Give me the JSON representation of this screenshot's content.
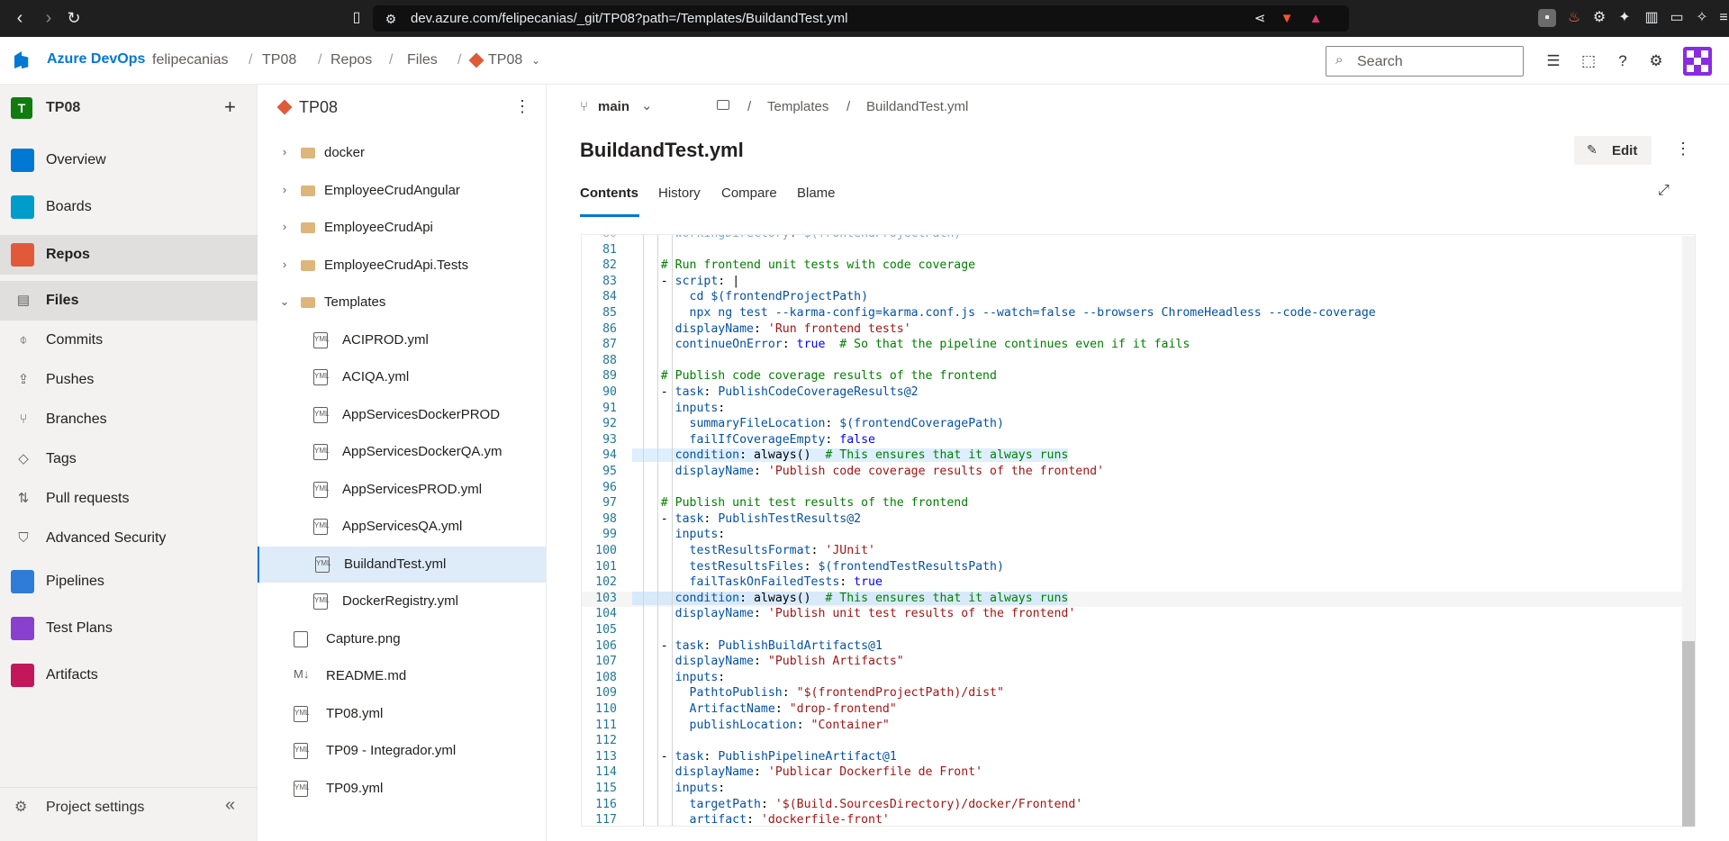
{
  "browser": {
    "url": "dev.azure.com/felipecanias/_git/TP08?path=/Templates/BuildandTest.yml",
    "nav_icons": [
      "back-icon",
      "forward-icon",
      "reload-icon",
      "bookmark-icon"
    ]
  },
  "header": {
    "brand": "Azure DevOps",
    "breadcrumbs": [
      "felipecanias",
      "TP08",
      "Repos",
      "Files",
      "TP08"
    ],
    "search_placeholder": "Search",
    "accent": "#0078d4"
  },
  "project": {
    "initial": "T",
    "name": "TP08",
    "add": "+"
  },
  "nav": {
    "items": [
      {
        "label": "Overview",
        "color": "#0078d4"
      },
      {
        "label": "Boards",
        "color": "#009ccc"
      },
      {
        "label": "Repos",
        "color": "#e05a3a"
      }
    ],
    "repos_sub": [
      {
        "label": "Files",
        "icon": "file-icon"
      },
      {
        "label": "Commits",
        "icon": "commit-icon"
      },
      {
        "label": "Pushes",
        "icon": "push-icon"
      },
      {
        "label": "Branches",
        "icon": "branch-icon"
      },
      {
        "label": "Tags",
        "icon": "tag-icon"
      },
      {
        "label": "Pull requests",
        "icon": "pull-request-icon"
      },
      {
        "label": "Advanced Security",
        "icon": "shield-icon"
      }
    ],
    "bottom_items": [
      {
        "label": "Pipelines",
        "color": "#2e7cd6"
      },
      {
        "label": "Test Plans",
        "color": "#8a3fcf"
      },
      {
        "label": "Artifacts",
        "color": "#c2185b"
      }
    ],
    "settings": "Project settings"
  },
  "tree": {
    "repo": "TP08",
    "items": [
      {
        "label": "docker",
        "type": "folder",
        "level": 0,
        "expanded": false
      },
      {
        "label": "EmployeeCrudAngular",
        "type": "folder",
        "level": 0,
        "expanded": false
      },
      {
        "label": "EmployeeCrudApi",
        "type": "folder",
        "level": 0,
        "expanded": false
      },
      {
        "label": "EmployeeCrudApi.Tests",
        "type": "folder",
        "level": 0,
        "expanded": false
      },
      {
        "label": "Templates",
        "type": "folder",
        "level": 0,
        "expanded": true
      },
      {
        "label": "ACIPROD.yml",
        "type": "file",
        "level": 1
      },
      {
        "label": "ACIQA.yml",
        "type": "file",
        "level": 1
      },
      {
        "label": "AppServicesDockerPROD",
        "type": "file",
        "level": 1
      },
      {
        "label": "AppServicesDockerQA.ym",
        "type": "file",
        "level": 1
      },
      {
        "label": "AppServicesPROD.yml",
        "type": "file",
        "level": 1
      },
      {
        "label": "AppServicesQA.yml",
        "type": "file",
        "level": 1
      },
      {
        "label": "BuildandTest.yml",
        "type": "file",
        "level": 1,
        "selected": true
      },
      {
        "label": "DockerRegistry.yml",
        "type": "file",
        "level": 1
      },
      {
        "label": "Capture.png",
        "type": "image",
        "level": 0
      },
      {
        "label": "README.md",
        "type": "md",
        "level": 0
      },
      {
        "label": "TP08.yml",
        "type": "file",
        "level": 0
      },
      {
        "label": "TP09 - Integrador.yml",
        "type": "file",
        "level": 0
      },
      {
        "label": "TP09.yml",
        "type": "file",
        "level": 0
      }
    ]
  },
  "file": {
    "branch": "main",
    "path": [
      "Templates",
      "BuildandTest.yml"
    ],
    "title": "BuildandTest.yml",
    "edit": "Edit",
    "tabs": [
      "Contents",
      "History",
      "Compare",
      "Blame"
    ],
    "active_tab": "Contents"
  },
  "code": {
    "lines": [
      {
        "n": "81",
        "t": ""
      },
      {
        "n": "82",
        "t": "    # Run frontend unit tests with code coverage"
      },
      {
        "n": "83",
        "t": "    - script: |"
      },
      {
        "n": "84",
        "t": "        cd $(frontendProjectPath)"
      },
      {
        "n": "85",
        "t": "        npx ng test --karma-config=karma.conf.js --watch=false --browsers ChromeHeadless --code-coverage"
      },
      {
        "n": "86",
        "t": "      displayName: 'Run frontend tests'"
      },
      {
        "n": "87",
        "t": "      continueOnError: true  # So that the pipeline continues even if it fails"
      },
      {
        "n": "88",
        "t": ""
      },
      {
        "n": "89",
        "t": "    # Publish code coverage results of the frontend"
      },
      {
        "n": "90",
        "t": "    - task: PublishCodeCoverageResults@2"
      },
      {
        "n": "91",
        "t": "      inputs:"
      },
      {
        "n": "92",
        "t": "        summaryFileLocation: $(frontendCoveragePath)"
      },
      {
        "n": "93",
        "t": "        failIfCoverageEmpty: false"
      },
      {
        "n": "94",
        "t": "      condition: always()  # This ensures that it always runs"
      },
      {
        "n": "95",
        "t": "      displayName: 'Publish code coverage results of the frontend'"
      },
      {
        "n": "96",
        "t": ""
      },
      {
        "n": "97",
        "t": "    # Publish unit test results of the frontend"
      },
      {
        "n": "98",
        "t": "    - task: PublishTestResults@2"
      },
      {
        "n": "99",
        "t": "      inputs:"
      },
      {
        "n": "100",
        "t": "        testResultsFormat: 'JUnit'"
      },
      {
        "n": "101",
        "t": "        testResultsFiles: $(frontendTestResultsPath)"
      },
      {
        "n": "102",
        "t": "        failTaskOnFailedTests: true"
      },
      {
        "n": "103",
        "t": "      condition: always()  # This ensures that it always runs"
      },
      {
        "n": "104",
        "t": "      displayName: 'Publish unit test results of the frontend'"
      },
      {
        "n": "105",
        "t": ""
      },
      {
        "n": "106",
        "t": "    - task: PublishBuildArtifacts@1"
      },
      {
        "n": "107",
        "t": "      displayName: \"Publish Artifacts\""
      },
      {
        "n": "108",
        "t": "      inputs:"
      },
      {
        "n": "109",
        "t": "        PathtoPublish: \"$(frontendProjectPath)/dist\""
      },
      {
        "n": "110",
        "t": "        ArtifactName: \"drop-frontend\""
      },
      {
        "n": "111",
        "t": "        publishLocation: \"Container\""
      },
      {
        "n": "112",
        "t": ""
      },
      {
        "n": "113",
        "t": "    - task: PublishPipelineArtifact@1"
      },
      {
        "n": "114",
        "t": "      displayName: 'Publicar Dockerfile de Front'"
      },
      {
        "n": "115",
        "t": "      inputs:"
      },
      {
        "n": "116",
        "t": "        targetPath: '$(Build.SourcesDirectory)/docker/Frontend'"
      },
      {
        "n": "117",
        "t": "        artifact: 'dockerfile-front'"
      }
    ],
    "partial_top": "      workingDirectory: $(frontendProjectPath)",
    "highlighted": [
      "94",
      "103"
    ]
  }
}
